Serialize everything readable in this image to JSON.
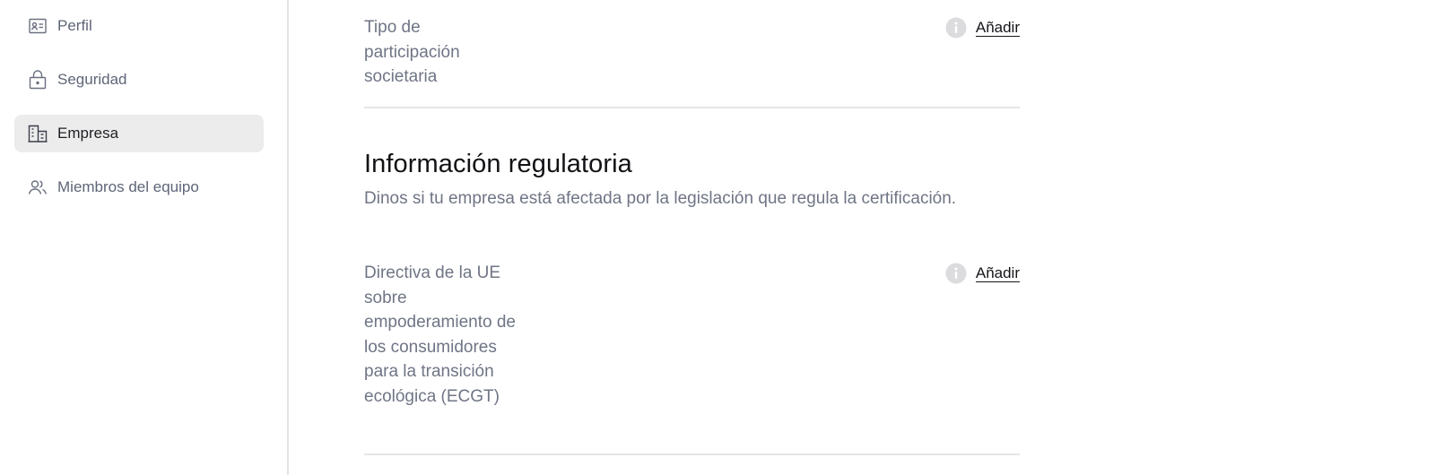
{
  "sidebar": {
    "items": [
      {
        "label": "Perfil",
        "icon": "id-card-icon",
        "active": false
      },
      {
        "label": "Seguridad",
        "icon": "lock-icon",
        "active": false
      },
      {
        "label": "Empresa",
        "icon": "building-icon",
        "active": true
      },
      {
        "label": "Miembros del equipo",
        "icon": "users-icon",
        "active": false
      }
    ]
  },
  "main": {
    "shareholding_field": {
      "label": "Tipo de participación societaria",
      "action": "Añadir"
    },
    "regulatory_section": {
      "title": "Información regulatoria",
      "description": "Dinos si tu empresa está afectada por la legislación que regula la certificación."
    },
    "ecgt_field": {
      "label": "Directiva de la UE sobre empoderamiento de los consumidores para la transición ecológica (ECGT)",
      "action": "Añadir"
    }
  },
  "colors": {
    "sidebar_active_bg": "#ececec",
    "muted_text": "#6f7585",
    "divider": "#e5e5e8"
  }
}
